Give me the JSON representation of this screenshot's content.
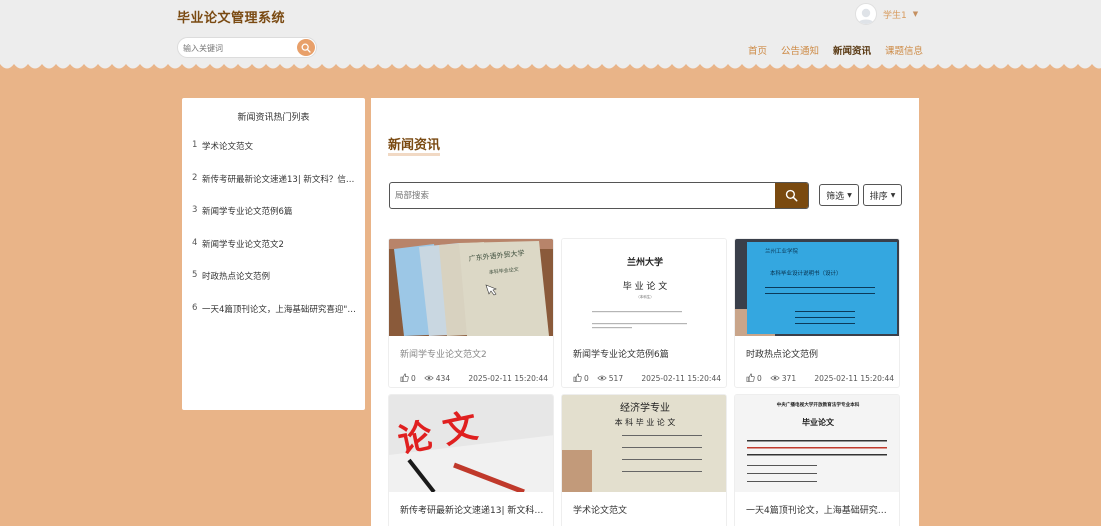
{
  "header": {
    "brand": "毕业论文管理系统",
    "user_name": "学生1",
    "search_placeholder": "输入关键词",
    "nav": [
      {
        "label": "首页",
        "active": false
      },
      {
        "label": "公告通知",
        "active": false
      },
      {
        "label": "新闻资讯",
        "active": true
      },
      {
        "label": "课题信息",
        "active": false
      }
    ]
  },
  "sidebar": {
    "title": "新闻资讯热门列表",
    "items": [
      {
        "num": "1",
        "label": "学术论文范文"
      },
      {
        "num": "2",
        "label": "新传考研最新论文速递13| 新文科？信…"
      },
      {
        "num": "3",
        "label": "新闻学专业论文范例6篇"
      },
      {
        "num": "4",
        "label": "新闻学专业论文范文2"
      },
      {
        "num": "5",
        "label": "时政热点论文范例"
      },
      {
        "num": "6",
        "label": "一天4篇顶刊论文，上海基础研究喜迎\"…"
      }
    ]
  },
  "main": {
    "title": "新闻资讯",
    "search_placeholder": "局部搜索",
    "filter_label": "筛选",
    "sort_label": "排序",
    "cards": [
      {
        "title": "新闻学专业论文范文2",
        "likes": "0",
        "views": "434",
        "date": "2025-02-11 15:20:44",
        "muted": true
      },
      {
        "title": "新闻学专业论文范例6篇",
        "likes": "0",
        "views": "517",
        "date": "2025-02-11 15:20:44",
        "muted": false
      },
      {
        "title": "时政热点论文范例",
        "likes": "0",
        "views": "371",
        "date": "2025-02-11 15:20:44",
        "muted": false
      },
      {
        "title": "新传考研最新论文速递13| 新文科…",
        "muted": false
      },
      {
        "title": "学术论文范文",
        "muted": false
      },
      {
        "title": "一天4篇顶刊论文，上海基础研究…",
        "muted": false
      }
    ],
    "thumb_text": {
      "c1_school": "广东外语外贸大学",
      "c1_sub": "本科毕业论文",
      "c2_school": "兰州大学",
      "c2_title": "毕 业 论 文",
      "c2_sub": "（本科生）",
      "c3_school": "兰州工业学院",
      "c3_title": "本科毕业设计说明书（设计）",
      "c4_title": "论 文",
      "c5_t1": "经济学专业",
      "c5_t2": "本 科 毕 业 论 文",
      "c6_head": "中央广播电视大学开放教育法学专业本科",
      "c6_title": "毕业论文"
    }
  }
}
